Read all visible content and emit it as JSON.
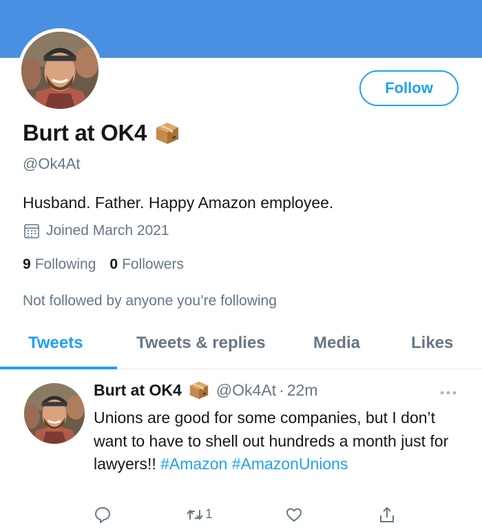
{
  "profile": {
    "display_name": "Burt at OK4",
    "handle": "@Ok4At",
    "bio": "Husband. Father. Happy Amazon employee.",
    "joined": "Joined March 2021",
    "following_count": "9",
    "following_label": "Following",
    "followers_count": "0",
    "followers_label": "Followers",
    "not_followed": "Not followed by anyone you’re following",
    "follow_label": "Follow"
  },
  "tabs": [
    {
      "label": "Tweets",
      "active": true
    },
    {
      "label": "Tweets & replies",
      "active": false
    },
    {
      "label": "Media",
      "active": false
    },
    {
      "label": "Likes",
      "active": false
    }
  ],
  "tweet": {
    "name": "Burt at OK4",
    "handle": "@Ok4At",
    "separator": "·",
    "time": "22m",
    "text": "Unions are good for some companies, but I don’t want to have to shell out hundreds a month just for lawyers!!",
    "hashtags": [
      "#Amazon",
      "#AmazonUnions"
    ],
    "retweet_count": "1"
  },
  "icons": {
    "name_badge": "package-box-icon",
    "joined": "calendar-icon",
    "more": "more-dots-icon",
    "reply": "reply-icon",
    "retweet": "retweet-icon",
    "like": "heart-icon",
    "share": "share-icon"
  },
  "colors": {
    "banner": "#4a90e2",
    "accent": "#1da1f2",
    "secondary_text": "#657786"
  }
}
